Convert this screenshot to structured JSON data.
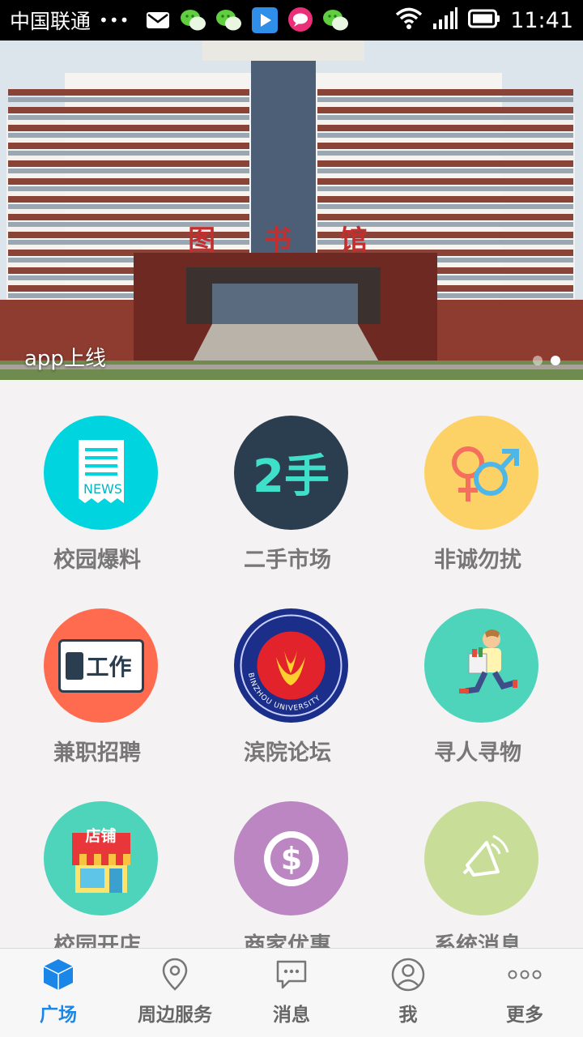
{
  "status_bar": {
    "carrier": "中国联通",
    "dots": "•••",
    "notification_icons": [
      "mail-icon",
      "wechat-icon",
      "wechat-icon",
      "video-player-icon",
      "chat-bubble-icon",
      "wechat-icon"
    ],
    "time": "11:41"
  },
  "banner": {
    "caption": "app上线",
    "building_sign": "图 书 馆",
    "page_count": 2,
    "active_page": 1
  },
  "grid": {
    "items": [
      {
        "label": "校园爆料",
        "icon": "news-icon",
        "color": "#00d4de"
      },
      {
        "label": "二手市场",
        "icon": "second-hand-icon",
        "icon_text": "2手",
        "color": "#2b3e50"
      },
      {
        "label": "非诚勿扰",
        "icon": "gender-icon",
        "color": "#fcd267"
      },
      {
        "label": "兼职招聘",
        "icon": "job-card-icon",
        "icon_text": "工作",
        "color": "#fe6b4f"
      },
      {
        "label": "滨院论坛",
        "icon": "university-logo-icon",
        "icon_text": "BINZHOU UNIVERSITY",
        "color": "#1a2e8a"
      },
      {
        "label": "寻人寻物",
        "icon": "running-man-icon",
        "color": "#4dd4bb"
      },
      {
        "label": "校园开店",
        "icon": "shop-icon",
        "icon_text": "店铺",
        "color": "#4dd4bb"
      },
      {
        "label": "商家优惠",
        "icon": "dollar-coin-icon",
        "color": "#bb86c2"
      },
      {
        "label": "系统消息",
        "icon": "speaker-icon",
        "color": "#c8dd98"
      }
    ]
  },
  "tab_bar": {
    "tabs": [
      {
        "label": "广场",
        "icon": "cube-icon",
        "active": true
      },
      {
        "label": "周边服务",
        "icon": "location-pin-icon",
        "active": false
      },
      {
        "label": "消息",
        "icon": "message-icon",
        "active": false
      },
      {
        "label": "我",
        "icon": "person-icon",
        "active": false
      },
      {
        "label": "更多",
        "icon": "more-dots-icon",
        "active": false
      }
    ],
    "accent_color": "#1a86e8"
  }
}
